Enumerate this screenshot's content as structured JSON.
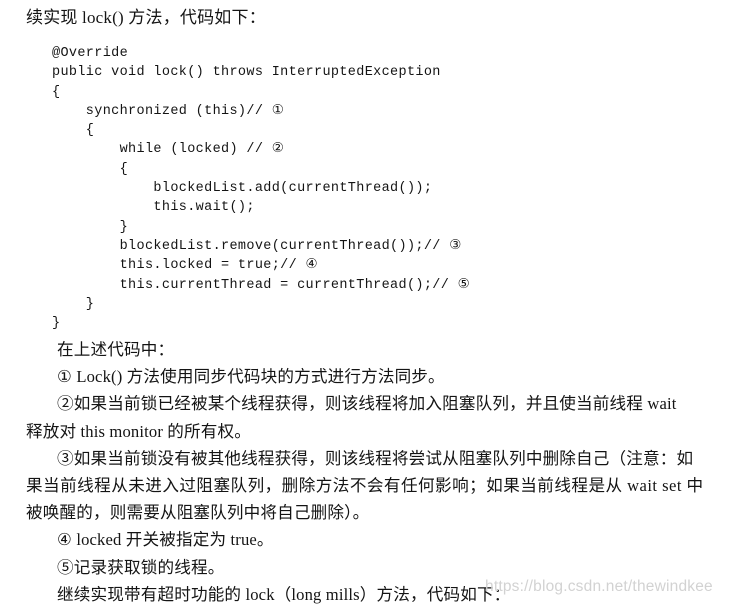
{
  "document": {
    "intro_line": "续实现 lock() 方法，代码如下：",
    "code": {
      "language": "java",
      "lines": [
        "@Override",
        "public void lock() throws InterruptedException",
        "{",
        "    synchronized (this)// ①",
        "    {",
        "        while (locked) // ②",
        "        {",
        "            blockedList.add(currentThread());",
        "            this.wait();",
        "        }",
        "        blockedList.remove(currentThread());// ③",
        "        this.locked = true;// ④",
        "        this.currentThread = currentThread();// ⑤",
        "    }",
        "}"
      ]
    },
    "body_lines": [
      "在上述代码中：",
      "① Lock() 方法使用同步代码块的方式进行方法同步。",
      "②如果当前锁已经被某个线程获得，则该线程将加入阻塞队列，并且使当前线程 wait",
      "释放对 this monitor 的所有权。",
      "③如果当前锁没有被其他线程获得，则该线程将尝试从阻塞队列中删除自己（注意：如",
      "果当前线程从未进入过阻塞队列，删除方法不会有任何影响；如果当前线程是从 wait set 中",
      "被唤醒的，则需要从阻塞队列中将自己删除）。",
      "④ locked 开关被指定为 true。",
      "⑤记录获取锁的线程。",
      "继续实现带有超时功能的 lock（long mills）方法，代码如下："
    ],
    "watermark": "https://blog.csdn.net/thewindkee"
  }
}
